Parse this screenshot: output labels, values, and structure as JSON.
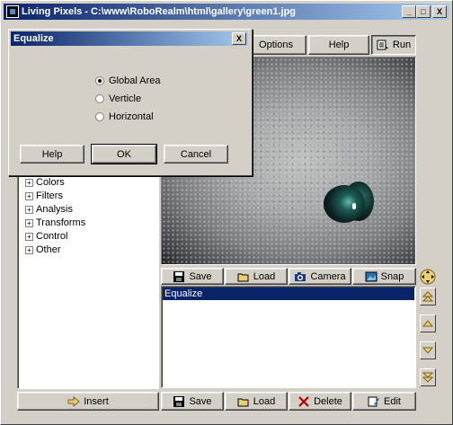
{
  "window": {
    "title": "Living Pixels - C:\\www\\RoboRealm\\html\\gallery\\green1.jpg",
    "controls": [
      "_",
      "□",
      "X"
    ]
  },
  "toolbar": {
    "options_label": "Options",
    "help_label": "Help",
    "run_label": "Run"
  },
  "dialog": {
    "title": "Equalize",
    "close_label": "X",
    "options": [
      {
        "label": "Global Area",
        "selected": true
      },
      {
        "label": "Verticle",
        "selected": false
      },
      {
        "label": "Horizontal",
        "selected": false
      }
    ],
    "help_label": "Help",
    "ok_label": "OK",
    "cancel_label": "Cancel"
  },
  "tree": {
    "items": [
      "Colors",
      "Filters",
      "Analysis",
      "Transforms",
      "Control",
      "Other"
    ]
  },
  "image_toolbar": {
    "save_label": "Save",
    "load_label": "Load",
    "camera_label": "Camera",
    "snap_label": "Snap"
  },
  "pipeline": {
    "items": [
      "Equalize"
    ]
  },
  "bottom_bar": {
    "insert_label": "Insert",
    "save_label": "Save",
    "load_label": "Load",
    "delete_label": "Delete",
    "edit_label": "Edit"
  },
  "colors": {
    "titlebar_start": "#0a246a",
    "titlebar_end": "#a6caf0",
    "face": "#d4d0c8",
    "selection": "#0a246a"
  }
}
